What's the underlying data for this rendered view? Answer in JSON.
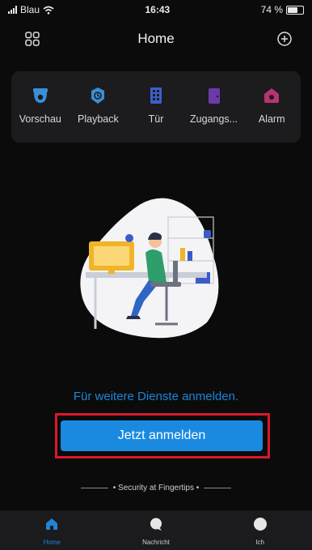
{
  "status_bar": {
    "carrier": "Blau",
    "time": "16:43",
    "battery": "74 %",
    "battery_level": 0.74
  },
  "header": {
    "title": "Home"
  },
  "quick_actions": [
    {
      "label": "Vorschau",
      "icon": "camera-icon",
      "color": "#3a8fd6"
    },
    {
      "label": "Playback",
      "icon": "playback-icon",
      "color": "#3a8fd6"
    },
    {
      "label": "Tür",
      "icon": "door-icon",
      "color": "#3d5fc8"
    },
    {
      "label": "Zugangs...",
      "icon": "access-icon",
      "color": "#6b3aa8"
    },
    {
      "label": "Alarm",
      "icon": "alarm-icon",
      "color": "#b8346e"
    }
  ],
  "main": {
    "prompt": "Für weitere Dienste anmelden.",
    "login_button": "Jetzt anmelden",
    "tagline": "• Security at Fingertips •"
  },
  "tabs": [
    {
      "label": "Home",
      "icon": "home-icon",
      "active": true
    },
    {
      "label": "Nachricht",
      "icon": "message-icon",
      "active": false
    },
    {
      "label": "Ich",
      "icon": "user-icon",
      "active": false
    }
  ],
  "colors": {
    "accent": "#1e84d8",
    "highlight_frame": "#d8192b"
  }
}
